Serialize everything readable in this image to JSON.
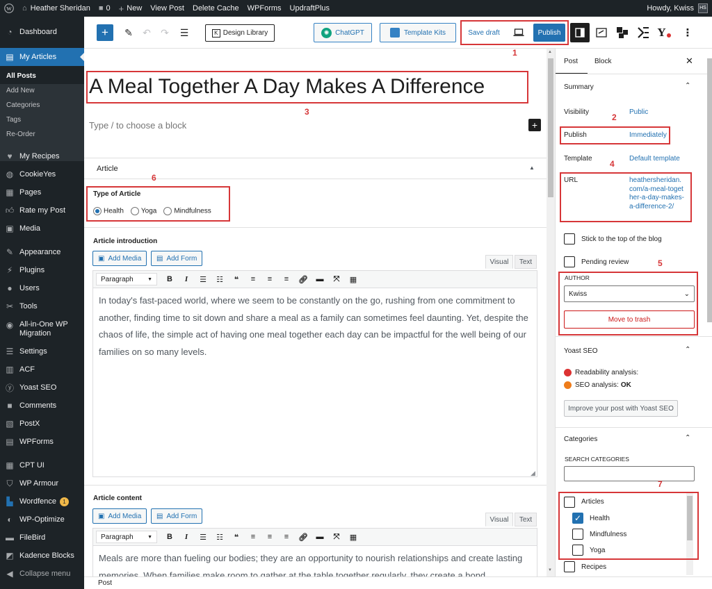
{
  "adminbar": {
    "site_name": "Heather Sheridan",
    "comments_count": "0",
    "new_label": "New",
    "view_post": "View Post",
    "delete_cache": "Delete Cache",
    "wpforms": "WPForms",
    "updraftplus": "UpdraftPlus",
    "howdy": "Howdy, Kwiss",
    "avatar_text": "HS"
  },
  "sidebar": {
    "dashboard": "Dashboard",
    "my_articles": "My Articles",
    "submenu": [
      "All Posts",
      "Add New",
      "Categories",
      "Tags",
      "Re-Order"
    ],
    "items": [
      "My Recipes",
      "CookieYes",
      "Pages",
      "Rate my Post",
      "Media",
      "Appearance",
      "Plugins",
      "Users",
      "Tools",
      "All-in-One WP Migration",
      "Settings",
      "ACF",
      "Yoast SEO",
      "Comments",
      "PostX",
      "WPForms",
      "CPT UI",
      "WP Armour",
      "Wordfence",
      "WP-Optimize",
      "FileBird",
      "Kadence Blocks"
    ],
    "wordfence_badge": "1",
    "collapse": "Collapse menu"
  },
  "toolbar": {
    "design_library": "Design Library",
    "chatgpt": "ChatGPT",
    "template_kits": "Template Kits",
    "save_draft": "Save draft",
    "publish": "Publish",
    "yoast_letter": "Y"
  },
  "annotations": [
    "1",
    "2",
    "3",
    "4",
    "5",
    "6",
    "7"
  ],
  "editor": {
    "title": "A Meal Together A Day Makes A Difference",
    "block_placeholder": "Type / to choose a block",
    "article_panel": "Article",
    "type_of_article_label": "Type of Article",
    "type_options": [
      "Health",
      "Yoga",
      "Mindfulness"
    ],
    "selected_type": "Health",
    "intro_label": "Article introduction",
    "add_media": "Add Media",
    "add_form": "Add Form",
    "tab_visual": "Visual",
    "tab_text": "Text",
    "format_select": "Paragraph",
    "intro_text": "In today's fast-paced world, where we seem to be constantly on the go, rushing from one commitment to another, finding time to sit down and share a meal as a family can sometimes feel daunting. Yet, despite the chaos of life, the simple act of having one meal together each day can be impactful for the well being of our families on so many levels.",
    "content_label": "Article content",
    "content_text": "Meals are more than fueling our bodies; they are an opportunity to nourish relationships and create lasting memories. When families make room to gather at the table together regularly, they create a bond",
    "footer_breadcrumb": "Post"
  },
  "settings": {
    "tab_post": "Post",
    "tab_block": "Block",
    "summary": "Summary",
    "visibility_label": "Visibility",
    "visibility_value": "Public",
    "publish_label": "Publish",
    "publish_value": "Immediately",
    "template_label": "Template",
    "template_value": "Default template",
    "url_label": "URL",
    "url_value": "heathersheridan.com/a-meal-together-a-day-makes-a-difference-2/",
    "sticky_label": "Stick to the top of the blog",
    "pending_label": "Pending review",
    "author_label": "AUTHOR",
    "author_value": "Kwiss",
    "trash": "Move to trash",
    "yoast_title": "Yoast SEO",
    "readability": "Readability analysis:",
    "seo_analysis": "SEO analysis:",
    "seo_result": "OK",
    "improve_button": "Improve your post with Yoast SEO",
    "categories_title": "Categories",
    "search_categories": "SEARCH CATEGORIES",
    "categories": [
      {
        "name": "Articles",
        "checked": false
      },
      {
        "name": "Health",
        "checked": true
      },
      {
        "name": "Mindfulness",
        "checked": false
      },
      {
        "name": "Yoga",
        "checked": false
      },
      {
        "name": "Recipes",
        "checked": false
      }
    ]
  }
}
